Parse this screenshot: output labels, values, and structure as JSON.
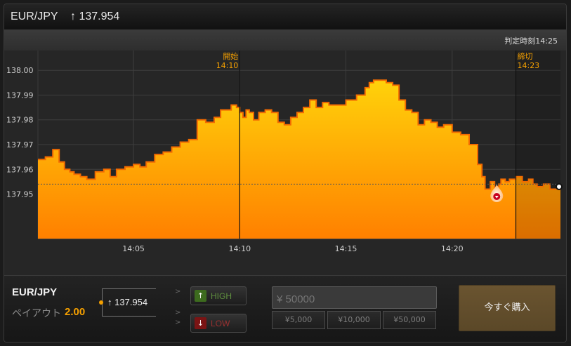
{
  "header": {
    "pair": "EUR/JPY",
    "arrow": "↑",
    "rate": "137.954"
  },
  "chart": {
    "judge_time": "判定時刻14:25",
    "start_label": "開始",
    "start_time": "14:10",
    "close_label": "締切",
    "close_time": "14:23"
  },
  "chart_data": {
    "type": "area",
    "title": "",
    "xlabel": "",
    "ylabel": "",
    "x_ticks": [
      "14:05",
      "14:10",
      "14:15",
      "14:20"
    ],
    "y_ticks": [
      "137.95",
      "137.96",
      "137.97",
      "137.98",
      "137.99",
      "138.00"
    ],
    "ylim": [
      137.932,
      138.008
    ],
    "xlim_minutes_after_1400": [
      0.5,
      25.1
    ],
    "start_marker": "14:10",
    "close_marker": "14:23",
    "current_rate": 137.954,
    "colors": {
      "fill_top": "#ffd20a",
      "fill_bottom": "#ff8000",
      "line": "#f26a00",
      "marker": "#c8001e"
    },
    "series": [
      {
        "x": [
          0.5,
          0.85,
          1.2,
          1.5,
          1.75,
          2.0,
          2.2,
          2.5,
          2.8,
          3.2,
          3.6,
          3.9,
          4.2,
          4.6,
          5.0,
          5.3,
          5.6,
          6.0,
          6.4,
          6.8,
          7.2,
          7.6,
          8.0,
          8.4,
          8.8,
          9.1,
          9.3,
          9.6,
          9.85,
          10.0,
          10.15,
          10.3,
          10.45,
          10.65,
          10.9,
          11.2,
          11.5,
          11.8,
          12.1,
          12.4,
          12.7,
          13.0,
          13.3,
          13.6,
          13.9,
          14.2,
          14.6,
          15.0,
          15.5,
          15.9,
          16.1,
          16.3,
          16.6,
          16.9,
          17.2,
          17.5,
          17.8,
          18.1,
          18.4,
          18.7,
          19.0,
          19.3,
          19.6,
          20.0,
          20.4,
          20.8,
          21.2,
          21.4,
          21.55,
          21.8,
          22.0,
          22.1,
          22.2,
          22.3,
          22.5,
          22.7,
          23.0,
          23.3,
          23.6,
          23.8,
          24.0,
          24.3,
          24.6,
          25.1
        ],
        "y": [
          137.964,
          137.965,
          137.968,
          137.963,
          137.96,
          137.959,
          137.958,
          137.957,
          137.956,
          137.959,
          137.96,
          137.957,
          137.96,
          137.961,
          137.962,
          137.961,
          137.963,
          137.966,
          137.967,
          137.969,
          137.971,
          137.972,
          137.98,
          137.979,
          137.981,
          137.984,
          137.984,
          137.986,
          137.985,
          137.983,
          137.981,
          137.984,
          137.983,
          137.98,
          137.983,
          137.984,
          137.983,
          137.979,
          137.978,
          137.981,
          137.983,
          137.985,
          137.988,
          137.985,
          137.987,
          137.986,
          137.986,
          137.988,
          137.99,
          137.993,
          137.995,
          137.996,
          137.996,
          137.995,
          137.994,
          137.988,
          137.984,
          137.983,
          137.978,
          137.98,
          137.979,
          137.977,
          137.978,
          137.975,
          137.974,
          137.97,
          137.962,
          137.957,
          137.952,
          137.955,
          137.951,
          137.953,
          137.954,
          137.956,
          137.955,
          137.956,
          137.957,
          137.955,
          137.956,
          137.954,
          137.953,
          137.954,
          137.952,
          137.953
        ]
      }
    ]
  },
  "bottom": {
    "pair": "EUR/JPY",
    "payout_label": "ペイアウト",
    "payout_value": "2.00",
    "arrow": "↑",
    "rate": "137.954",
    "gt": ">",
    "high_label": "HIGH",
    "low_label": "LOW",
    "high_icon": "↑",
    "low_icon": "↓",
    "amount_placeholder": "¥ 50000",
    "quick_amounts": [
      "¥5,000",
      "¥10,000",
      "¥50,000"
    ],
    "buy_label": "今すぐ購入"
  }
}
